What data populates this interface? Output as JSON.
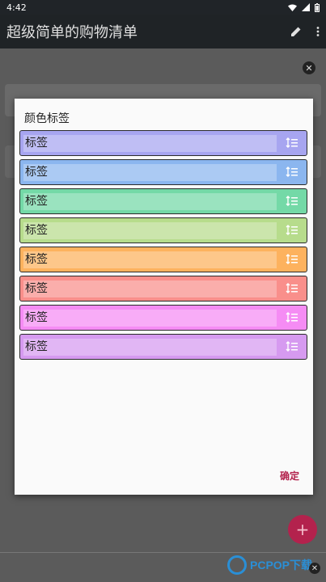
{
  "status_bar": {
    "time": "4:42"
  },
  "app_bar": {
    "title": "超级简单的购物清单"
  },
  "dialog": {
    "title": "颜色标签",
    "tags": [
      {
        "label": "标签",
        "color": "#a7a5f0"
      },
      {
        "label": "标签",
        "color": "#8bb6ef"
      },
      {
        "label": "标签",
        "color": "#74d9a7"
      },
      {
        "label": "标签",
        "color": "#b7dc8c"
      },
      {
        "label": "标签",
        "color": "#fdb25e"
      },
      {
        "label": "标签",
        "color": "#f98f8b"
      },
      {
        "label": "标签",
        "color": "#f58cf4"
      },
      {
        "label": "标签",
        "color": "#d69af0"
      }
    ],
    "ok_label": "确定"
  },
  "fab": {
    "label": "+"
  },
  "watermark": {
    "text": "PCPOP下载"
  },
  "colors": {
    "accent": "#b3224d",
    "app_bar": "#1f2326"
  }
}
